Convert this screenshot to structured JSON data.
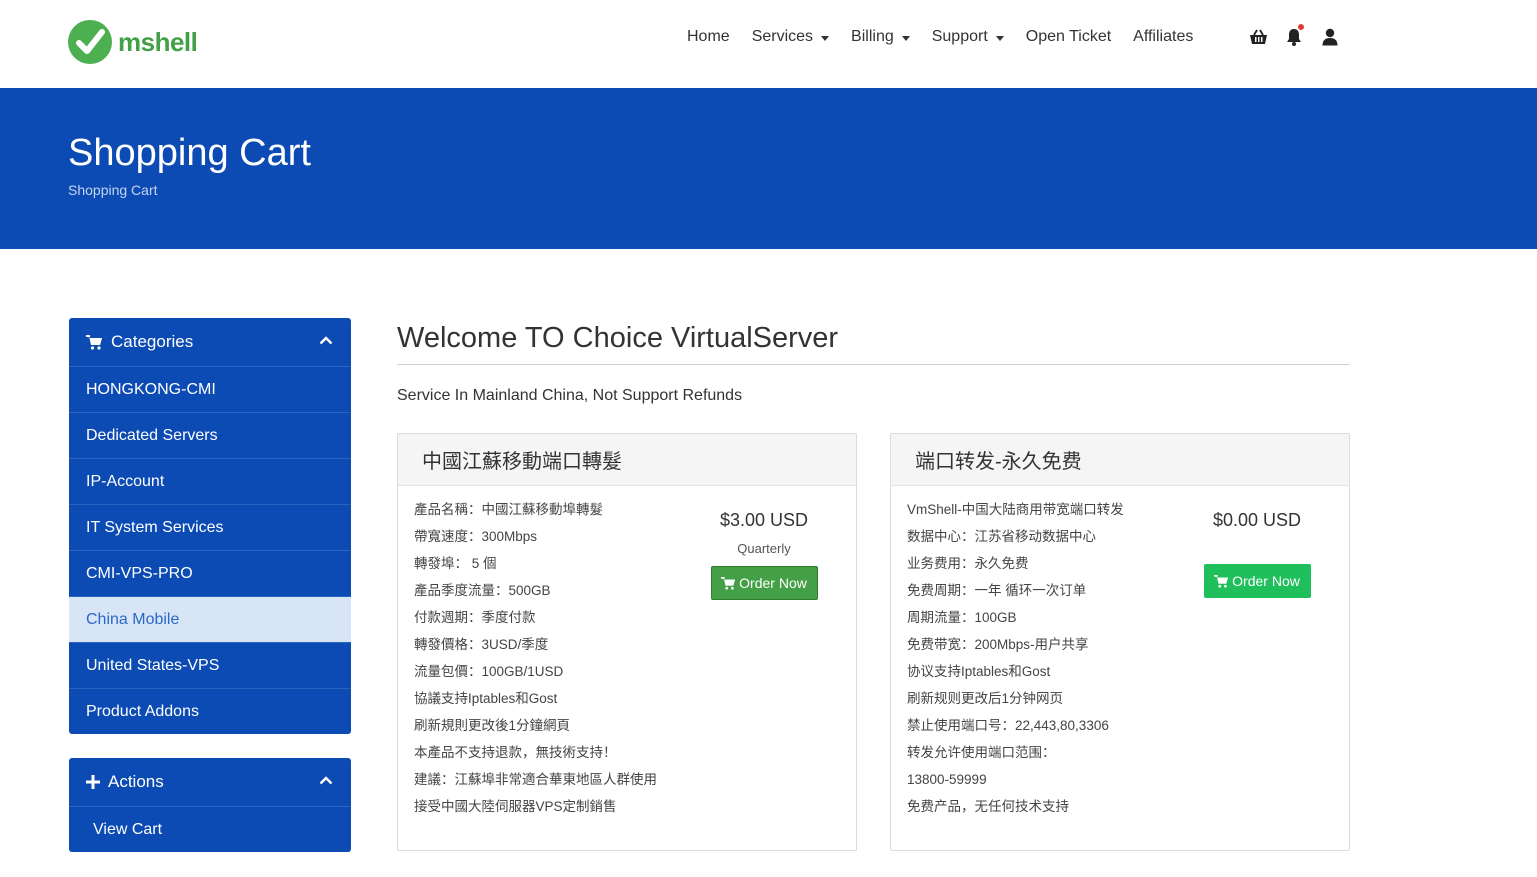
{
  "brand": {
    "name": "mshell",
    "logo_color": "#4caf50"
  },
  "nav": {
    "items": [
      {
        "label": "Home",
        "dropdown": false
      },
      {
        "label": "Services",
        "dropdown": true
      },
      {
        "label": "Billing",
        "dropdown": true
      },
      {
        "label": "Support",
        "dropdown": true
      },
      {
        "label": "Open Ticket",
        "dropdown": false
      },
      {
        "label": "Affiliates",
        "dropdown": false
      }
    ],
    "icons": [
      "basket-icon",
      "bell-icon",
      "user-icon"
    ]
  },
  "banner": {
    "title": "Shopping Cart",
    "breadcrumb": "Shopping Cart",
    "color": "#0b4bb3"
  },
  "sidebar": {
    "categories": {
      "title": "Categories",
      "items": [
        {
          "label": "HONGKONG-CMI",
          "active": false
        },
        {
          "label": "Dedicated Servers",
          "active": false
        },
        {
          "label": "IP-Account",
          "active": false
        },
        {
          "label": "IT System Services",
          "active": false
        },
        {
          "label": "CMI-VPS-PRO",
          "active": false
        },
        {
          "label": "China Mobile",
          "active": true
        },
        {
          "label": "United States-VPS",
          "active": false
        },
        {
          "label": "Product Addons",
          "active": false
        }
      ]
    },
    "actions": {
      "title": "Actions",
      "items": [
        {
          "label": "View Cart"
        }
      ]
    }
  },
  "main": {
    "title": "Welcome TO Choice VirtualServer",
    "description": "Service In Mainland China, Not Support Refunds",
    "products": [
      {
        "name": "中國江蘇移動端口轉髮",
        "features": [
          "產品名稱：中國江蘇移動埠轉髮",
          "帶寬速度：300Mbps",
          "轉發埠： 5 個",
          "產品季度流量：500GB",
          "付款週期：季度付款",
          "轉發價格：3USD/季度",
          "流量包價：100GB/1USD",
          "協議支持Iptables和Gost",
          "刷新規則更改後1分鐘網頁",
          "本產品不支持退款，無技術支持！",
          "建議：江蘇埠非常適合華東地區人群使用",
          "接受中國大陸伺服器VPS定制銷售"
        ],
        "price": "$3.00 USD",
        "cycle": "Quarterly",
        "order_label": "Order Now"
      },
      {
        "name": "端口转发-永久免费",
        "features": [
          "VmShell-中国大陆商用带宽端口转发",
          "数据中心：江苏省移动数据中心",
          "业务费用：永久免费",
          "免费周期：一年 循环一次订单",
          "周期流量：100GB",
          "免费带宽：200Mbps-用户共享",
          "协议支持Iptables和Gost",
          "刷新规则更改后1分钟网页",
          "禁止使用端口号：22,443,80,3306",
          "转发允许使用端口范围：",
          "13800-59999",
          "免费产品，无任何技术支持"
        ],
        "price": "$0.00 USD",
        "cycle": "",
        "order_label": "Order Now"
      }
    ]
  }
}
